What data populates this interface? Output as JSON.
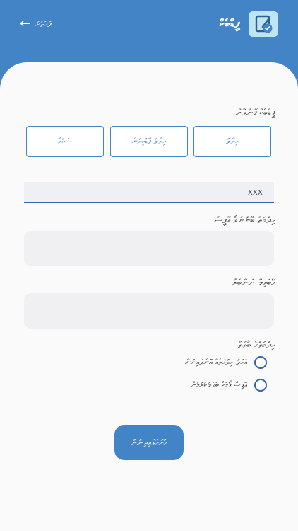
{
  "header": {
    "back_label": "ފަހަތަށް",
    "app_name": "ފީޑްބެކް"
  },
  "form": {
    "section_type_label": "ފީޑްބެކް ފޮނުވާން",
    "types": [
      "ހިޔާލު",
      "ހިޔާލު ފާޑުކިޔުން",
      "ޝަކުވާ"
    ],
    "id_field_value": "xxx",
    "organization_label": "ހިދުމަތް ބޭނުންވާ އޮފީސް",
    "contact_label": "މޯބައިލް ނަންބަރު",
    "service_type_label": "ހިދުމަތުގެ ބާވަތް",
    "options": [
      "އަމަލު ހިދުމަތެއް އޮންލައިނުން",
      "އޮފީސް ފޯމަކާ ބަދަލުކުރުމުން"
    ],
    "submit_label": "ހުށަހަޅައިދިނުން"
  },
  "colors": {
    "primary": "#4384c7",
    "accent": "#3463a8",
    "card": "#fbfafb"
  },
  "icons": {
    "back": "arrow-left-icon",
    "logo": "feedback-edit-icon"
  }
}
